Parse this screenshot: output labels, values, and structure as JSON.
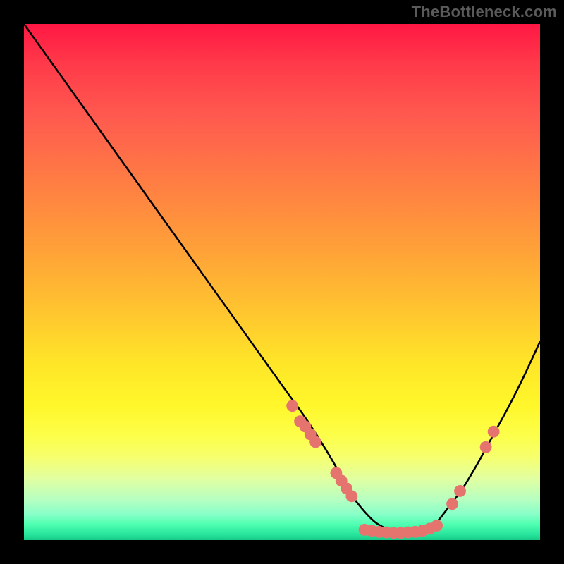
{
  "watermark": "TheBottleneck.com",
  "chart_data": {
    "type": "line",
    "title": "",
    "xlabel": "",
    "ylabel": "",
    "xlim": [
      0,
      100
    ],
    "ylim": [
      0,
      100
    ],
    "grid": false,
    "legend": false,
    "series": [
      {
        "name": "curve",
        "x": [
          0,
          5,
          10,
          15,
          20,
          25,
          30,
          35,
          40,
          45,
          50,
          55,
          60,
          62,
          64,
          66,
          68,
          70,
          72,
          74,
          76,
          78,
          80,
          82,
          85,
          88,
          91,
          94,
          97,
          100
        ],
        "y": [
          100,
          93,
          86,
          79,
          72,
          65,
          58,
          51,
          44,
          37,
          30,
          23,
          15,
          11,
          8,
          5.5,
          3.5,
          2.3,
          1.5,
          1.2,
          1.3,
          2.0,
          3.5,
          6.0,
          10.0,
          15.0,
          20.5,
          26.0,
          32.0,
          38.5
        ]
      }
    ],
    "markers": [
      {
        "x": 52.0,
        "y": 26.0
      },
      {
        "x": 53.5,
        "y": 23.0
      },
      {
        "x": 54.5,
        "y": 22.0
      },
      {
        "x": 55.5,
        "y": 20.5
      },
      {
        "x": 56.5,
        "y": 19.0
      },
      {
        "x": 60.5,
        "y": 13.0
      },
      {
        "x": 61.5,
        "y": 11.5
      },
      {
        "x": 62.5,
        "y": 10.0
      },
      {
        "x": 63.5,
        "y": 8.5
      },
      {
        "x": 66.0,
        "y": 2.0
      },
      {
        "x": 67.4,
        "y": 1.8
      },
      {
        "x": 68.8,
        "y": 1.6
      },
      {
        "x": 70.2,
        "y": 1.5
      },
      {
        "x": 71.6,
        "y": 1.4
      },
      {
        "x": 73.0,
        "y": 1.4
      },
      {
        "x": 74.4,
        "y": 1.5
      },
      {
        "x": 75.8,
        "y": 1.6
      },
      {
        "x": 77.2,
        "y": 1.8
      },
      {
        "x": 78.6,
        "y": 2.2
      },
      {
        "x": 80.0,
        "y": 2.8
      },
      {
        "x": 83.0,
        "y": 7.0
      },
      {
        "x": 84.5,
        "y": 9.5
      },
      {
        "x": 89.5,
        "y": 18.0
      },
      {
        "x": 91.0,
        "y": 21.0
      }
    ],
    "marker_color": "#e5746f",
    "marker_radius_pct": 1.15,
    "gradient_stops": [
      {
        "pos": 0.0,
        "color": "#ff1744"
      },
      {
        "pos": 0.18,
        "color": "#ff5a4f"
      },
      {
        "pos": 0.44,
        "color": "#ffa238"
      },
      {
        "pos": 0.66,
        "color": "#ffe628"
      },
      {
        "pos": 0.84,
        "color": "#f6ff6e"
      },
      {
        "pos": 0.95,
        "color": "#88ffc8"
      },
      {
        "pos": 1.0,
        "color": "#18c987"
      }
    ]
  }
}
